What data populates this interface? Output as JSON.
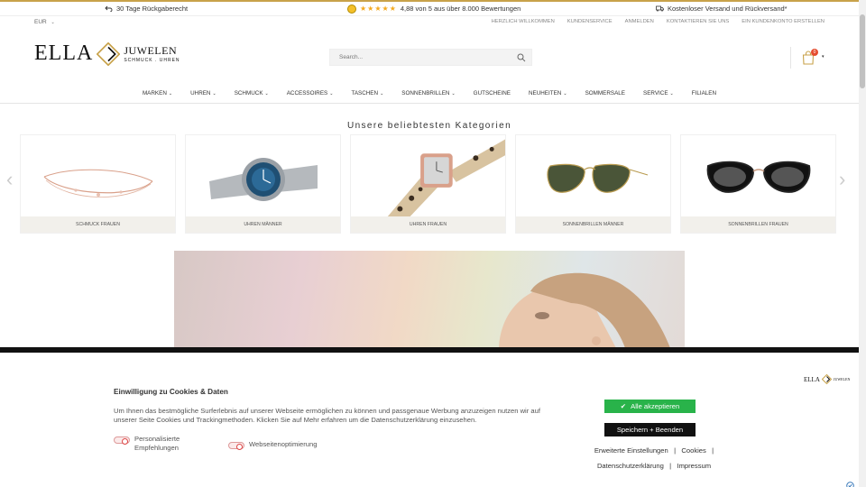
{
  "topbar": {
    "usp_left": "30 Tage Rückgaberecht",
    "rating_stars": "★★★★★",
    "rating_text": "4,88 von 5 aus über 8.000 Bewertungen",
    "usp_right": "Kostenloser Versand und Rückversand*"
  },
  "header": {
    "currency": "EUR",
    "toplinks": [
      "HERZLICH WILLKOMMEN",
      "KUNDENSERVICE",
      "ANMELDEN",
      "KONTAKTIEREN SIE UNS",
      "EIN KUNDENKONTO ERSTELLEN"
    ],
    "logo_ella": "ELLA",
    "logo_juwelen": "JUWELEN",
    "logo_sub": "SCHMUCK . UHREN",
    "search_placeholder": "Search...",
    "cart_count": "0"
  },
  "nav": {
    "items": [
      {
        "label": "MARKEN",
        "caret": true
      },
      {
        "label": "UHREN",
        "caret": true
      },
      {
        "label": "SCHMUCK",
        "caret": true
      },
      {
        "label": "ACCESSOIRES",
        "caret": true
      },
      {
        "label": "TASCHEN",
        "caret": true
      },
      {
        "label": "SONNENBRILLEN",
        "caret": true
      },
      {
        "label": "GUTSCHEINE",
        "caret": false
      },
      {
        "label": "NEUHEITEN",
        "caret": true
      },
      {
        "label": "SOMMERSALE",
        "caret": false
      },
      {
        "label": "SERVICE",
        "caret": true
      },
      {
        "label": "FILIALEN",
        "caret": false
      }
    ]
  },
  "categories": {
    "title": "Unsere beliebtesten Kategorien",
    "items": [
      {
        "label": "SCHMUCK FRAUEN",
        "icon": "bracelet-image"
      },
      {
        "label": "UHREN MÄNNER",
        "icon": "mens-watch-image"
      },
      {
        "label": "UHREN FRAUEN",
        "icon": "womens-watch-image"
      },
      {
        "label": "SONNENBRILLEN MÄNNER",
        "icon": "aviator-sunglasses-image"
      },
      {
        "label": "SONNENBRILLEN FRAUEN",
        "icon": "cat-eye-sunglasses-image"
      }
    ]
  },
  "cookie": {
    "title": "Einwilligung zu Cookies & Daten",
    "text": "Um Ihnen das bestmögliche Surferlebnis auf unserer Webseite ermöglichen zu können und passgenaue Werbung anzuzeigen nutzen wir auf unserer Seite Cookies und Trackingmethoden. Klicken Sie auf Mehr erfahren um die Datenschutzerklärung einzusehen.",
    "toggle_personalized": "Personalisierte Empfehlungen",
    "toggle_optimization": "Webseitenoptimierung",
    "accept_label": "Alle akzeptieren",
    "save_label": "Speichern + Beenden",
    "link_advanced": "Erweiterte Einstellungen",
    "link_cookies": "Cookies",
    "link_privacy": "Datenschutzerklärung",
    "link_imprint": "Impressum",
    "sep": "|",
    "logo_ella": "ELLA",
    "logo_juwelen": "JUWELEN"
  },
  "colors": {
    "accent_gold": "#c8a24a",
    "accept_green": "#29b34a",
    "cart_badge": "#e54c2e"
  }
}
